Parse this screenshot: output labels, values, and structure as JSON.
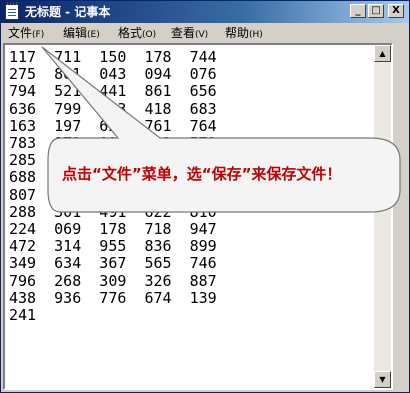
{
  "window": {
    "title": "无标题 - 记事本",
    "buttons": {
      "minimize": "_",
      "maximize": "□",
      "close": "X"
    }
  },
  "menu": {
    "items": [
      {
        "label": "文件",
        "accel": "(F)"
      },
      {
        "label": "编辑",
        "accel": "(E)"
      },
      {
        "label": "格式",
        "accel": "(O)"
      },
      {
        "label": "查看",
        "accel": "(V)"
      },
      {
        "label": "帮助",
        "accel": "(H)"
      }
    ]
  },
  "editor": {
    "lines": [
      "117  711  150  178  744",
      "275  861  043  094  076",
      "794  521  441  861  656",
      "636  799  203  418  683",
      "163  197  621  761  764",
      "783  873  194  413  573",
      "285  846  716  214  716",
      "688  471  374  641  874",
      "807  561  461  071  261",
      "288  301  491  622  810",
      "224  069  178  718  947",
      "472  314  955  836  899",
      "349  634  367  565  746",
      "796  268  309  326  887",
      "438  936  776  674  139",
      "241"
    ]
  },
  "callout": {
    "text": "点击“文件”菜单，选“保存”来保存文件！",
    "color": "#c00000"
  },
  "scrollbar": {
    "up_icon": "arrow-up-icon",
    "down_icon": "arrow-down-icon"
  }
}
